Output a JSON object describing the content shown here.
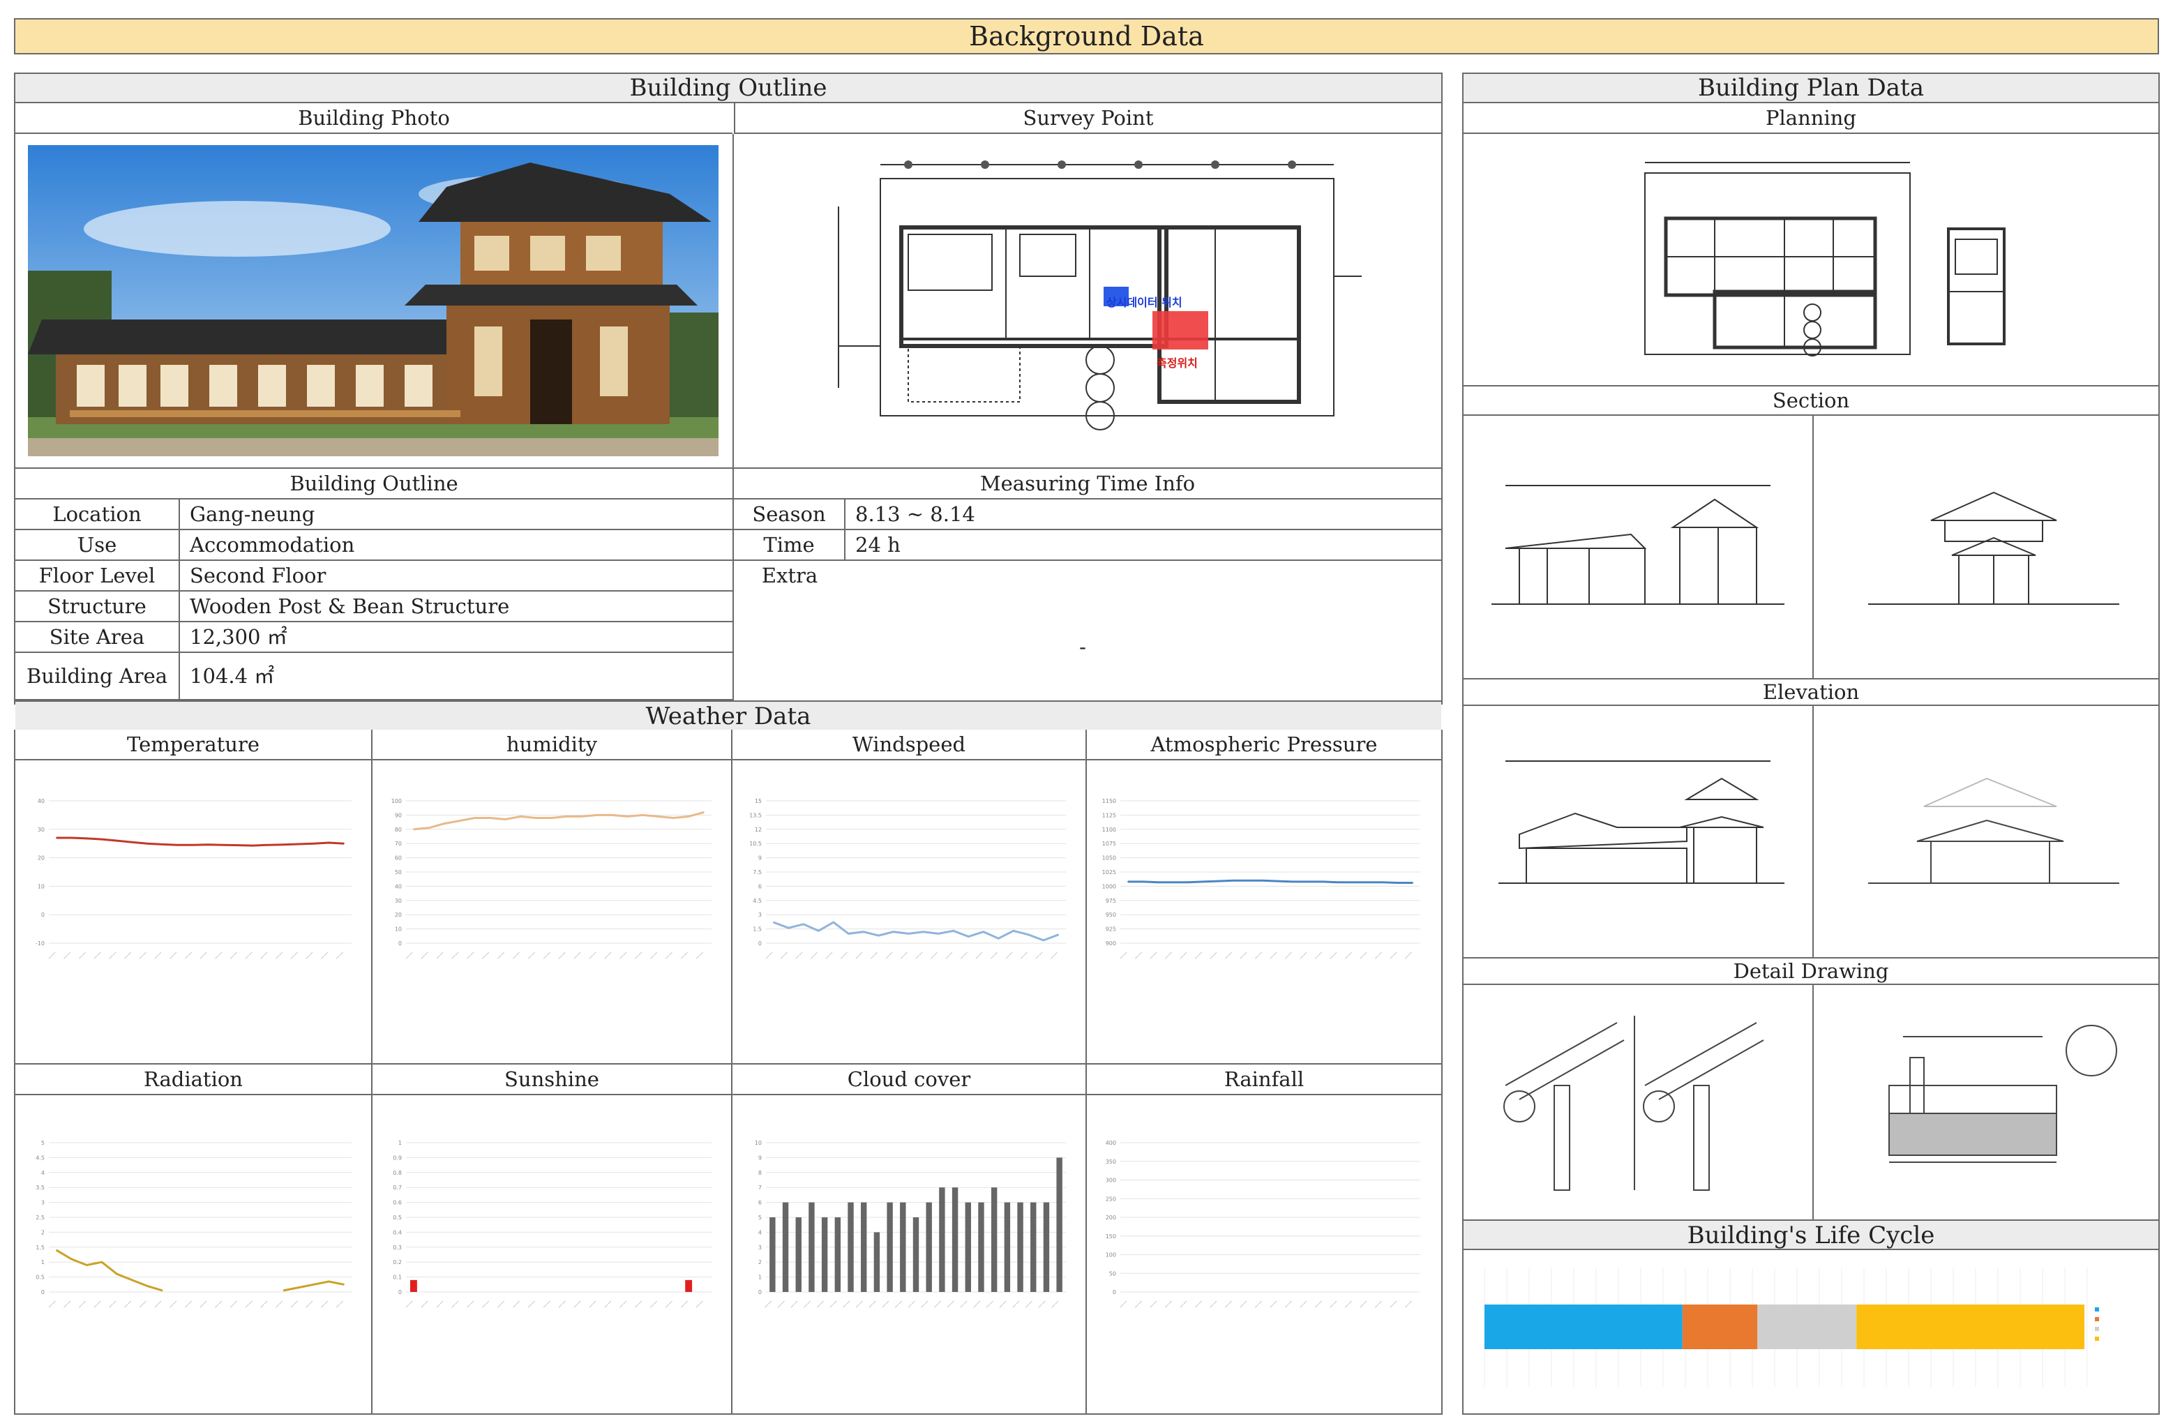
{
  "title": "Background Data",
  "building_outline": {
    "header": "Building Outline",
    "photo_label": "Building Photo",
    "survey_label": "Survey Point",
    "survey_text_blue": "상시데이터 위치",
    "survey_text_red": "측정위치",
    "outline_label": "Building Outline",
    "measuring_label": "Measuring Time Info",
    "rows": [
      {
        "label": "Location",
        "value": "Gang-neung"
      },
      {
        "label": "Use",
        "value": "Accommodation"
      },
      {
        "label": "Floor Level",
        "value": "Second Floor"
      },
      {
        "label": "Structure",
        "value": "Wooden Post & Bean Structure"
      },
      {
        "label": "Site Area",
        "value": "12,300 ㎡"
      },
      {
        "label": "Building Area",
        "value": "104.4 ㎡"
      }
    ],
    "measure": [
      {
        "label": "Season",
        "value": "8.13 ~ 8.14"
      },
      {
        "label": "Time",
        "value": "24 h"
      },
      {
        "label": "Extra",
        "value": "-"
      }
    ]
  },
  "weather": {
    "header": "Weather Data",
    "labels": [
      "Temperature",
      "humidity",
      "Windspeed",
      "Atmospheric Pressure",
      "Radiation",
      "Sunshine",
      "Cloud cover",
      "Rainfall"
    ]
  },
  "plan": {
    "header": "Building Plan Data",
    "planning": "Planning",
    "section": "Section",
    "elevation": "Elevation",
    "detail": "Detail Drawing",
    "lifecycle": "Building's Life Cycle",
    "lifecycle_colors": [
      "#1aa7e8",
      "#e8792f",
      "#cfcfcf",
      "#fcbf10"
    ],
    "lifecycle_fractions": [
      0.33,
      0.125,
      0.165,
      0.38
    ]
  },
  "chart_data": [
    {
      "type": "line",
      "key": "temperature",
      "ylim": [
        -10,
        40
      ],
      "yticks": [
        "40",
        "30",
        "20",
        "10",
        "0",
        "-10"
      ],
      "color": "#c0392b",
      "values": [
        27,
        27,
        26.8,
        26.5,
        26,
        25.5,
        25,
        24.7,
        24.5,
        24.5,
        24.6,
        24.5,
        24.4,
        24.3,
        24.5,
        24.6,
        24.8,
        25,
        25.3,
        25
      ]
    },
    {
      "type": "line",
      "key": "humidity",
      "ylim": [
        0,
        100
      ],
      "yticks": [
        "100",
        "90",
        "80",
        "70",
        "60",
        "50",
        "40",
        "30",
        "20",
        "10",
        "0"
      ],
      "color": "#e8b98a",
      "values": [
        80,
        81,
        84,
        86,
        88,
        88,
        87,
        89,
        88,
        88,
        89,
        89,
        90,
        90,
        89,
        90,
        89,
        88,
        89,
        92
      ]
    },
    {
      "type": "line",
      "key": "windspeed",
      "ylim": [
        0,
        15
      ],
      "yticks": [
        "15",
        "13.5",
        "12",
        "10.5",
        "9",
        "7.5",
        "6",
        "4.5",
        "3",
        "1.5",
        "0"
      ],
      "color": "#8fb4dc",
      "values": [
        2.2,
        1.6,
        2.0,
        1.3,
        2.2,
        1.0,
        1.2,
        0.8,
        1.2,
        1.0,
        1.2,
        1.0,
        1.3,
        0.7,
        1.2,
        0.5,
        1.3,
        0.9,
        0.3,
        0.9
      ]
    },
    {
      "type": "line",
      "key": "pressure",
      "ylim": [
        900,
        1150
      ],
      "yticks": [
        "1150",
        "1125",
        "1100",
        "1075",
        "1050",
        "1025",
        "1000",
        "975",
        "950",
        "925",
        "900"
      ],
      "color": "#4a86c5",
      "values": [
        1008,
        1008,
        1007,
        1007,
        1007,
        1008,
        1009,
        1010,
        1010,
        1010,
        1009,
        1008,
        1008,
        1008,
        1007,
        1007,
        1007,
        1007,
        1006,
        1006
      ]
    },
    {
      "type": "line",
      "key": "radiation",
      "ylim": [
        0,
        5
      ],
      "yticks": [
        "5",
        "4.5",
        "4",
        "3.5",
        "3",
        "2.5",
        "2",
        "1.5",
        "1",
        "0.5",
        "0"
      ],
      "color": "#c9a227",
      "values": [
        1.4,
        1.1,
        0.9,
        1.0,
        0.6,
        0.4,
        0.2,
        0.05,
        null,
        null,
        null,
        null,
        null,
        null,
        null,
        0.05,
        0.15,
        0.25,
        0.35,
        0.25
      ]
    },
    {
      "type": "bar",
      "key": "sunshine",
      "ylim": [
        0,
        1
      ],
      "yticks": [
        "1",
        "0.9",
        "0.8",
        "0.7",
        "0.6",
        "0.5",
        "0.4",
        "0.3",
        "0.2",
        "0.1",
        "0"
      ],
      "color": "#e02020",
      "values": [
        0.08,
        0,
        0,
        0,
        0,
        0,
        0,
        0,
        0,
        0,
        0,
        0,
        0,
        0,
        0,
        0,
        0,
        0,
        0.08,
        0
      ]
    },
    {
      "type": "bar",
      "key": "cloud",
      "ylim": [
        0,
        10
      ],
      "yticks": [
        "10",
        "9",
        "8",
        "7",
        "6",
        "5",
        "4",
        "3",
        "2",
        "1",
        "0"
      ],
      "color": "#666666",
      "values": [
        5,
        6,
        5,
        6,
        5,
        5,
        6,
        6,
        4,
        6,
        6,
        5,
        6,
        7,
        7,
        6,
        6,
        7,
        6,
        6,
        6,
        6,
        9
      ]
    },
    {
      "type": "bar",
      "key": "rainfall",
      "ylim": [
        0,
        400
      ],
      "yticks": [
        "400",
        "350",
        "300",
        "250",
        "200",
        "150",
        "100",
        "50",
        "0"
      ],
      "color": "#4a86c5",
      "values": [
        0,
        0,
        0,
        0,
        0,
        0,
        0,
        0,
        0,
        0,
        0,
        0,
        0,
        0,
        0,
        0,
        0,
        0,
        0,
        0
      ]
    }
  ]
}
